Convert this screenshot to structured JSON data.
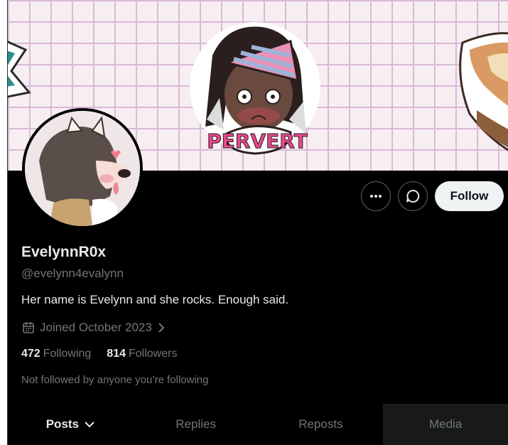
{
  "profile": {
    "display_name": "EvelynnR0x",
    "handle": "@evelynn4evalynn",
    "bio": "Her name is Evelynn and she rocks. Enough said.",
    "joined": "Joined October 2023",
    "following_count": "472",
    "following_label": "Following",
    "followers_count": "814",
    "followers_label": "Followers",
    "not_followed_text": "Not followed by anyone you’re following",
    "banner_sticker_text": "PERVERT"
  },
  "actions": {
    "more_icon": "more-icon",
    "message_icon": "message-icon",
    "follow_label": "Follow"
  },
  "tabs": [
    {
      "label": "Posts"
    },
    {
      "label": "Replies"
    },
    {
      "label": "Reposts"
    },
    {
      "label": "Media"
    }
  ],
  "colors": {
    "background": "#000000",
    "text": "#e7e9ea",
    "muted": "#71767b",
    "follow_bg": "#eff3f4"
  }
}
